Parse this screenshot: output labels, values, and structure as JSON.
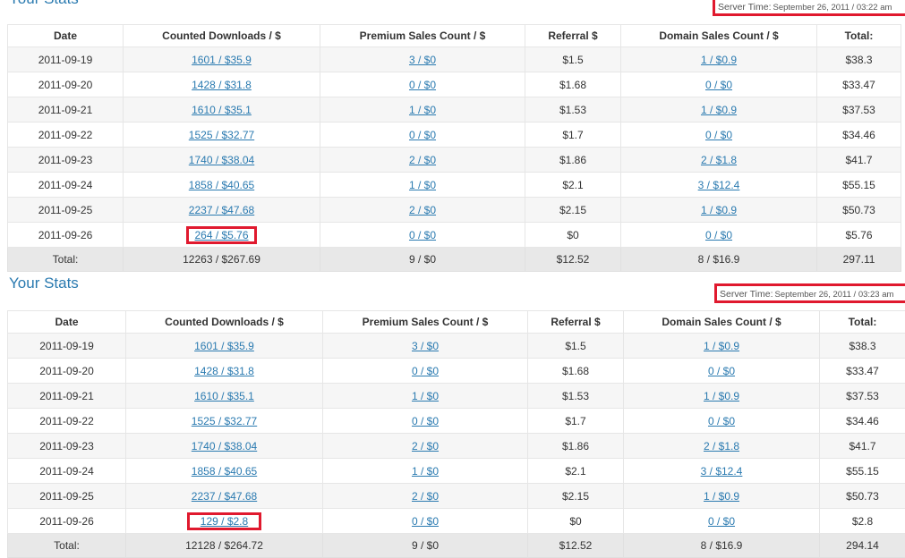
{
  "panels": [
    {
      "title": "Your Stats",
      "server_time_label": "Server Time:",
      "server_time_value": "September 26, 2011 / 03:22 am",
      "headers": [
        "Date",
        "Counted Downloads / $",
        "Premium Sales Count / $",
        "Referral $",
        "Domain Sales Count / $",
        "Total:"
      ],
      "rows": [
        {
          "date": "2011-09-19",
          "downloads": "1601 / $35.9",
          "premium": "3 / $0",
          "referral": "$1.5",
          "domain": "1 / $0.9",
          "total": "$38.3"
        },
        {
          "date": "2011-09-20",
          "downloads": "1428 / $31.8",
          "premium": "0 / $0",
          "referral": "$1.68",
          "domain": "0 / $0",
          "total": "$33.47"
        },
        {
          "date": "2011-09-21",
          "downloads": "1610 / $35.1",
          "premium": "1 / $0",
          "referral": "$1.53",
          "domain": "1 / $0.9",
          "total": "$37.53"
        },
        {
          "date": "2011-09-22",
          "downloads": "1525 / $32.77",
          "premium": "0 / $0",
          "referral": "$1.7",
          "domain": "0 / $0",
          "total": "$34.46"
        },
        {
          "date": "2011-09-23",
          "downloads": "1740 / $38.04",
          "premium": "2 / $0",
          "referral": "$1.86",
          "domain": "2 / $1.8",
          "total": "$41.7"
        },
        {
          "date": "2011-09-24",
          "downloads": "1858 / $40.65",
          "premium": "1 / $0",
          "referral": "$2.1",
          "domain": "3 / $12.4",
          "total": "$55.15"
        },
        {
          "date": "2011-09-25",
          "downloads": "2237 / $47.68",
          "premium": "2 / $0",
          "referral": "$2.15",
          "domain": "1 / $0.9",
          "total": "$50.73"
        },
        {
          "date": "2011-09-26",
          "downloads": "264 / $5.76",
          "premium": "0 / $0",
          "referral": "$0",
          "domain": "0 / $0",
          "total": "$5.76"
        }
      ],
      "footer": {
        "label": "Total:",
        "downloads": "12263 / $267.69",
        "premium": "9 / $0",
        "referral": "$12.52",
        "domain": "8 / $16.9",
        "total": "297.11"
      }
    },
    {
      "title": "Your Stats",
      "server_time_label": "Server Time:",
      "server_time_value": "September 26, 2011 / 03:23 am",
      "headers": [
        "Date",
        "Counted Downloads / $",
        "Premium Sales Count / $",
        "Referral $",
        "Domain Sales Count / $",
        "Total:"
      ],
      "rows": [
        {
          "date": "2011-09-19",
          "downloads": "1601 / $35.9",
          "premium": "3 / $0",
          "referral": "$1.5",
          "domain": "1 / $0.9",
          "total": "$38.3"
        },
        {
          "date": "2011-09-20",
          "downloads": "1428 / $31.8",
          "premium": "0 / $0",
          "referral": "$1.68",
          "domain": "0 / $0",
          "total": "$33.47"
        },
        {
          "date": "2011-09-21",
          "downloads": "1610 / $35.1",
          "premium": "1 / $0",
          "referral": "$1.53",
          "domain": "1 / $0.9",
          "total": "$37.53"
        },
        {
          "date": "2011-09-22",
          "downloads": "1525 / $32.77",
          "premium": "0 / $0",
          "referral": "$1.7",
          "domain": "0 / $0",
          "total": "$34.46"
        },
        {
          "date": "2011-09-23",
          "downloads": "1740 / $38.04",
          "premium": "2 / $0",
          "referral": "$1.86",
          "domain": "2 / $1.8",
          "total": "$41.7"
        },
        {
          "date": "2011-09-24",
          "downloads": "1858 / $40.65",
          "premium": "1 / $0",
          "referral": "$2.1",
          "domain": "3 / $12.4",
          "total": "$55.15"
        },
        {
          "date": "2011-09-25",
          "downloads": "2237 / $47.68",
          "premium": "2 / $0",
          "referral": "$2.15",
          "domain": "1 / $0.9",
          "total": "$50.73"
        },
        {
          "date": "2011-09-26",
          "downloads": "129 / $2.8",
          "premium": "0 / $0",
          "referral": "$0",
          "domain": "0 / $0",
          "total": "$2.8"
        }
      ],
      "footer": {
        "label": "Total:",
        "downloads": "12128 / $264.72",
        "premium": "9 / $0",
        "referral": "$12.52",
        "domain": "8 / $16.9",
        "total": "294.14"
      }
    }
  ],
  "colors": {
    "link": "#2a7ab0",
    "highlight_border": "#e0192e",
    "footer_bg": "#e8e8e8",
    "stripe_bg": "#f6f6f6"
  }
}
